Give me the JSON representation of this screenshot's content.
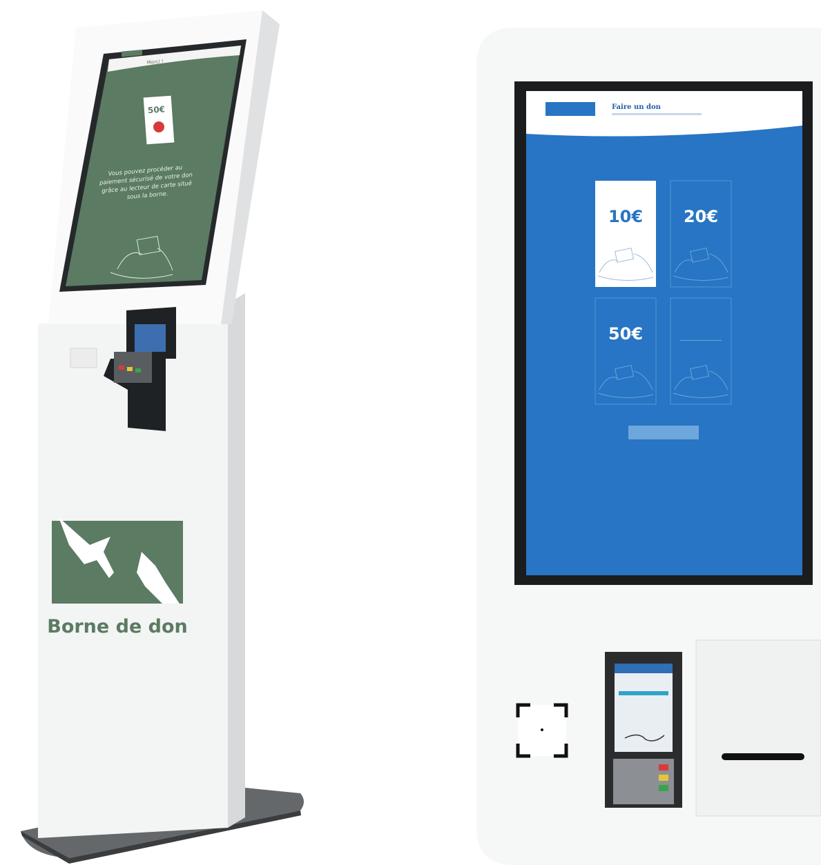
{
  "left_kiosk": {
    "screen_header_title": "Merci !",
    "card_amount": "50€",
    "screen_message": [
      "Vous pouvez procéder au",
      "paiement sécurisé de votre don",
      "grâce au lecteur de carte situé",
      "sous la borne."
    ],
    "brand_title": "Borne de don",
    "colors": {
      "green": "#5b7b63",
      "light": "#f4f4f4",
      "base": "#6b6e70"
    }
  },
  "right_kiosk": {
    "header_button_label": "",
    "header_title": "Faire un don",
    "amount_tiles": [
      {
        "amount": "10€",
        "selected": true
      },
      {
        "amount": "20€",
        "selected": false
      },
      {
        "amount": "50€",
        "selected": false
      },
      {
        "amount": "",
        "selected": false
      }
    ],
    "validate_button_label": "",
    "colors": {
      "blue": "#2775c4",
      "white": "#ffffff"
    }
  }
}
